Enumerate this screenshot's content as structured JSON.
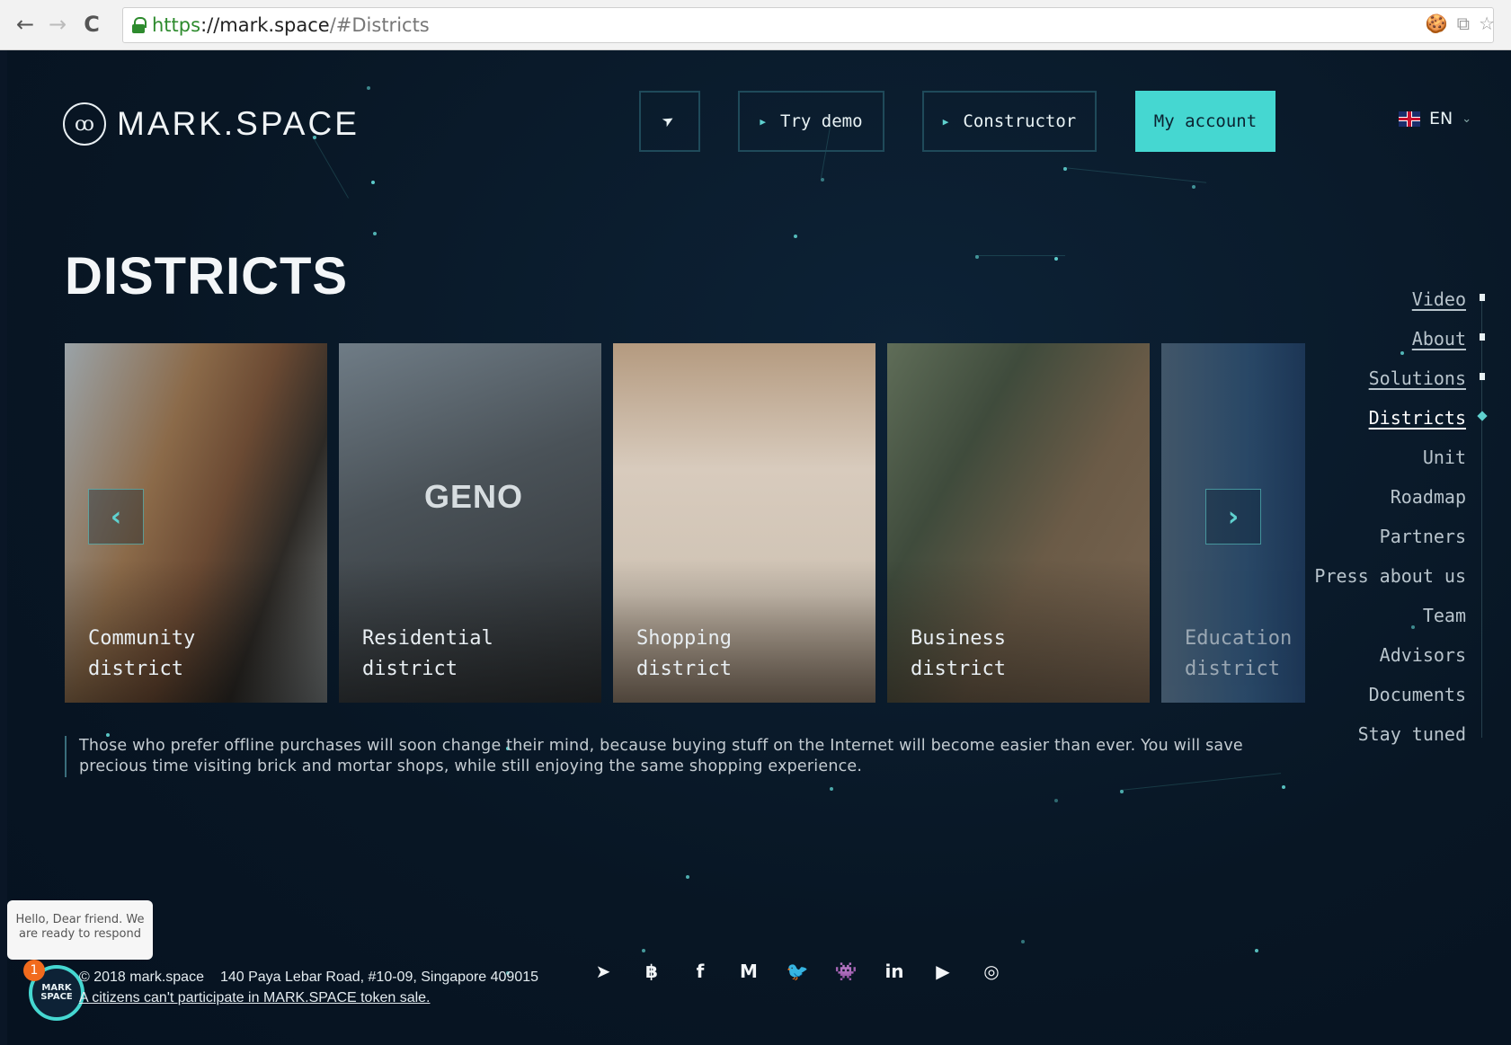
{
  "browser": {
    "url_scheme": "https",
    "url_host": "://mark.space",
    "url_path": "/#Districts",
    "back": "←",
    "forward": "→",
    "reload": "C",
    "ext_icons": [
      "🍪",
      "⧉",
      "☆"
    ]
  },
  "header": {
    "logo_mark": "ꝏ",
    "logo_text": "MARK.SPACE",
    "telegram_glyph": "➤",
    "try_demo": "Try demo",
    "constructor": "Constructor",
    "my_account": "My account",
    "lang": "EN",
    "lang_chevron": "⌄"
  },
  "section_title": "DISTRICTS",
  "districts": [
    {
      "label": "Community\ndistrict"
    },
    {
      "label": "Residential\ndistrict",
      "sign": "GENO"
    },
    {
      "label": "Shopping\ndistrict"
    },
    {
      "label": "Business\ndistrict"
    },
    {
      "label": "Education\ndistrict"
    }
  ],
  "slider": {
    "prev": "‹",
    "next": "›"
  },
  "description": "Those who prefer offline purchases will soon change their mind, because buying stuff on the Internet will become easier than ever. You will save precious time visiting brick and mortar shops, while still enjoying the same shopping experience.",
  "sidenav": [
    {
      "label": "Video"
    },
    {
      "label": "About"
    },
    {
      "label": "Solutions"
    },
    {
      "label": "Districts",
      "active": true
    },
    {
      "label": "Unit"
    },
    {
      "label": "Roadmap"
    },
    {
      "label": "Partners"
    },
    {
      "label": "Press about us"
    },
    {
      "label": "Team"
    },
    {
      "label": "Advisors"
    },
    {
      "label": "Documents"
    },
    {
      "label": "Stay tuned"
    }
  ],
  "chat": {
    "greeting": "Hello, Dear friend. We are ready to respond",
    "badge": "1",
    "avatar_text": "MARK SPACE"
  },
  "footer": {
    "copyright": "2018 mark.space",
    "address": "140 Paya Lebar Road, #10-09, Singapore 409015",
    "notice": "A citizens can't participate in MARK.SPACE token sale."
  },
  "socials": [
    {
      "name": "telegram",
      "glyph": "➤"
    },
    {
      "name": "bitcointalk",
      "glyph": "฿"
    },
    {
      "name": "facebook",
      "glyph": "f"
    },
    {
      "name": "medium",
      "glyph": "M"
    },
    {
      "name": "twitter",
      "glyph": "🐦"
    },
    {
      "name": "reddit",
      "glyph": "👾"
    },
    {
      "name": "linkedin",
      "glyph": "in"
    },
    {
      "name": "youtube",
      "glyph": "▶"
    },
    {
      "name": "instagram",
      "glyph": "◎"
    }
  ],
  "colors": {
    "accent": "#45d7d1",
    "background": "#0a1626"
  }
}
